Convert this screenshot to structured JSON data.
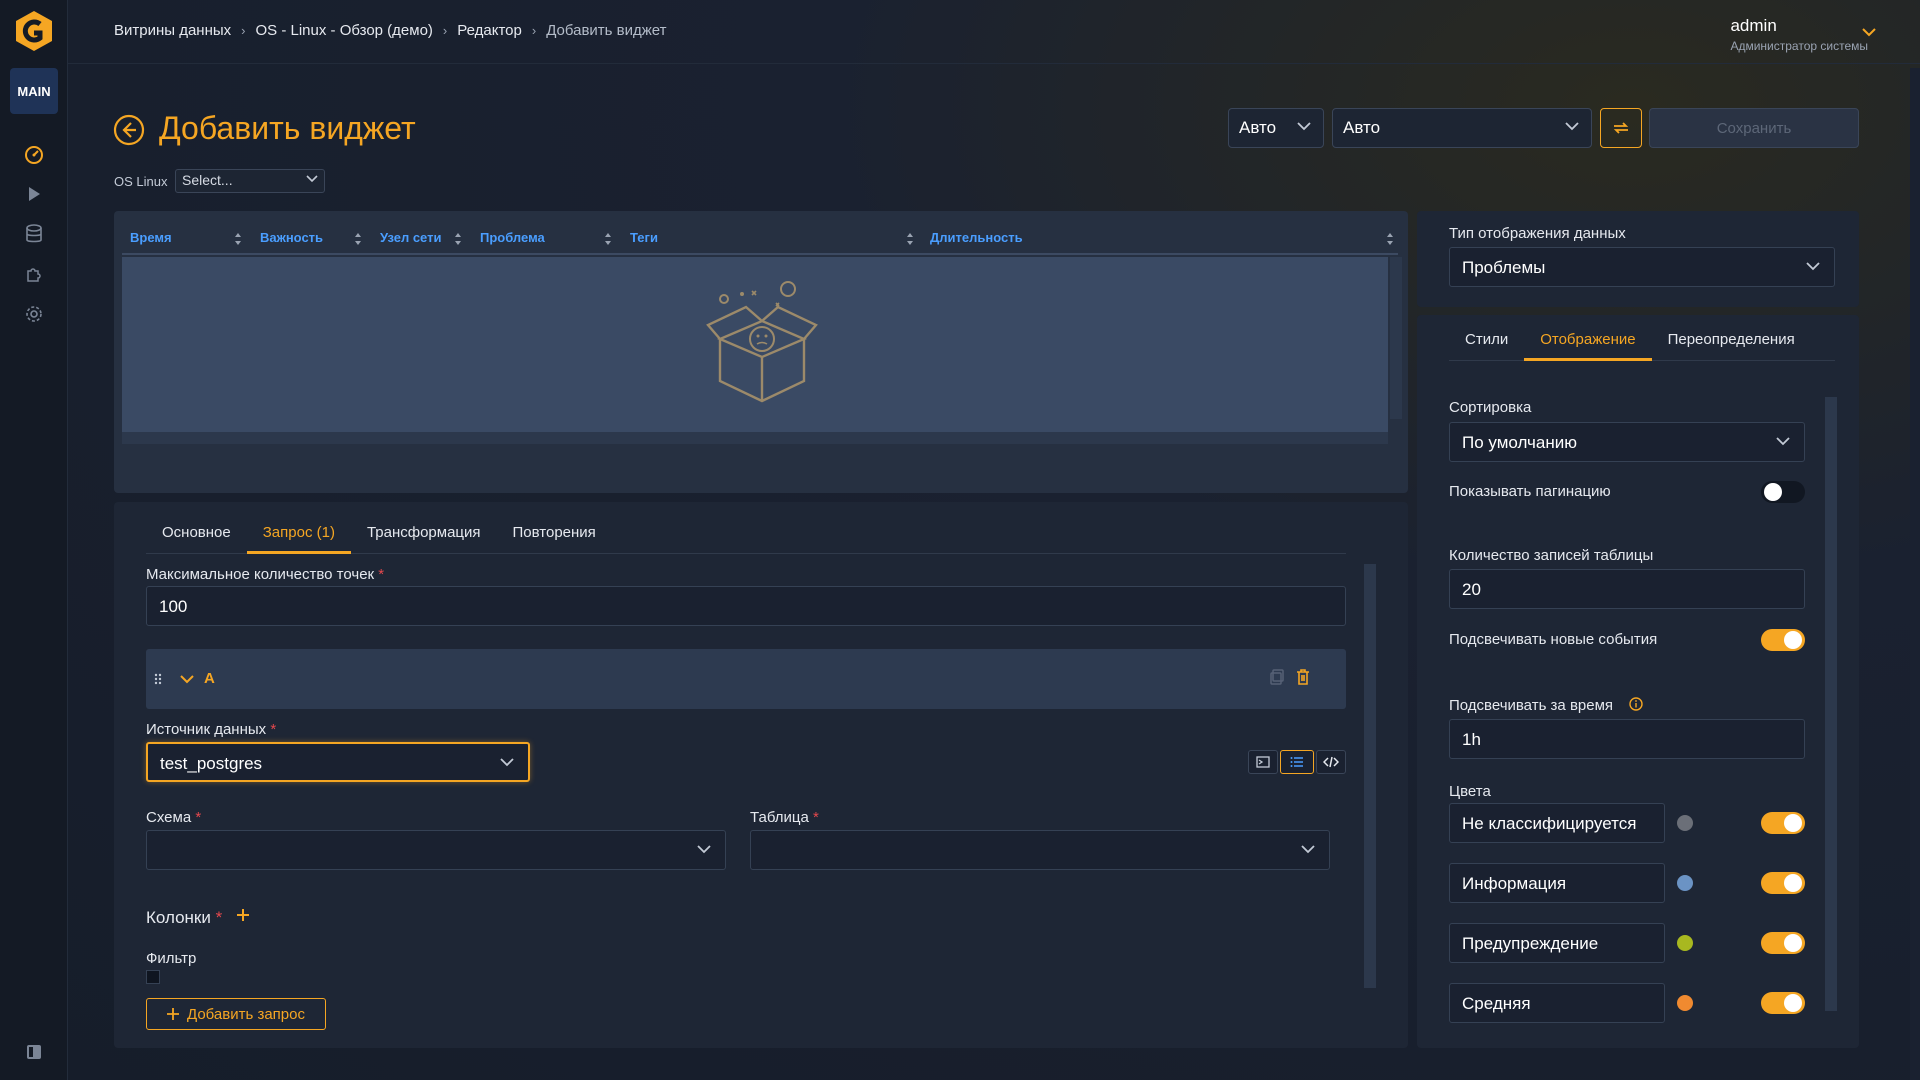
{
  "sidebar": {
    "badge": "MAIN",
    "icons": [
      "dashboard-icon",
      "play-icon",
      "database-icon",
      "puzzle-icon",
      "gear-icon"
    ]
  },
  "breadcrumb": [
    "Витрины данных",
    "OS - Linux - Обзор (демо)",
    "Редактор",
    "Добавить виджет"
  ],
  "user": {
    "name": "admin",
    "role": "Администратор системы"
  },
  "page": {
    "title": "Добавить виджет"
  },
  "variable": {
    "label": "OS Linux",
    "placeholder": "Select..."
  },
  "header": {
    "interval": "Авто",
    "refresh": "Авто",
    "save": "Сохранить"
  },
  "table": {
    "columns": [
      "Время",
      "Важность",
      "Узел сети",
      "Проблема",
      "Теги",
      "Длительность"
    ]
  },
  "query_panel": {
    "tabs": [
      "Основное",
      "Запрос (1)",
      "Трансформация",
      "Повторения"
    ],
    "active_tab": "Запрос (1)",
    "max_points_label": "Максимальное количество точек",
    "max_points_value": "100",
    "query_letter": "A",
    "datasource_label": "Источник данных",
    "datasource_value": "test_postgres",
    "schema_label": "Схема",
    "table_label": "Таблица",
    "columns_label": "Колонки",
    "filter_label": "Фильтр",
    "add_query": "Добавить запрос"
  },
  "display_type": {
    "label": "Тип отображения данных",
    "value": "Проблемы"
  },
  "options": {
    "tabs": [
      "Стили",
      "Отображение",
      "Переопределения"
    ],
    "active_tab": "Отображение",
    "sort_label": "Сортировка",
    "sort_value": "По умолчанию",
    "pagination_label": "Показывать пагинацию",
    "pagination_on": false,
    "rows_label": "Количество записей таблицы",
    "rows_value": "20",
    "highlight_label": "Подсвечивать новые события",
    "highlight_on": true,
    "highlight_time_label": "Подсвечивать за время",
    "highlight_time_value": "1h",
    "colors_label": "Цвета",
    "colors": [
      {
        "name": "Не классифицируется",
        "color": "#6b6f78",
        "on": true
      },
      {
        "name": "Информация",
        "color": "#6b93c4",
        "on": true
      },
      {
        "name": "Предупреждение",
        "color": "#a8b820",
        "on": true
      },
      {
        "name": "Средняя",
        "color": "#f08a30",
        "on": true
      }
    ]
  },
  "colors": {
    "accent": "#f5a623",
    "link": "#4a9eff",
    "panel": "#1e2635"
  }
}
